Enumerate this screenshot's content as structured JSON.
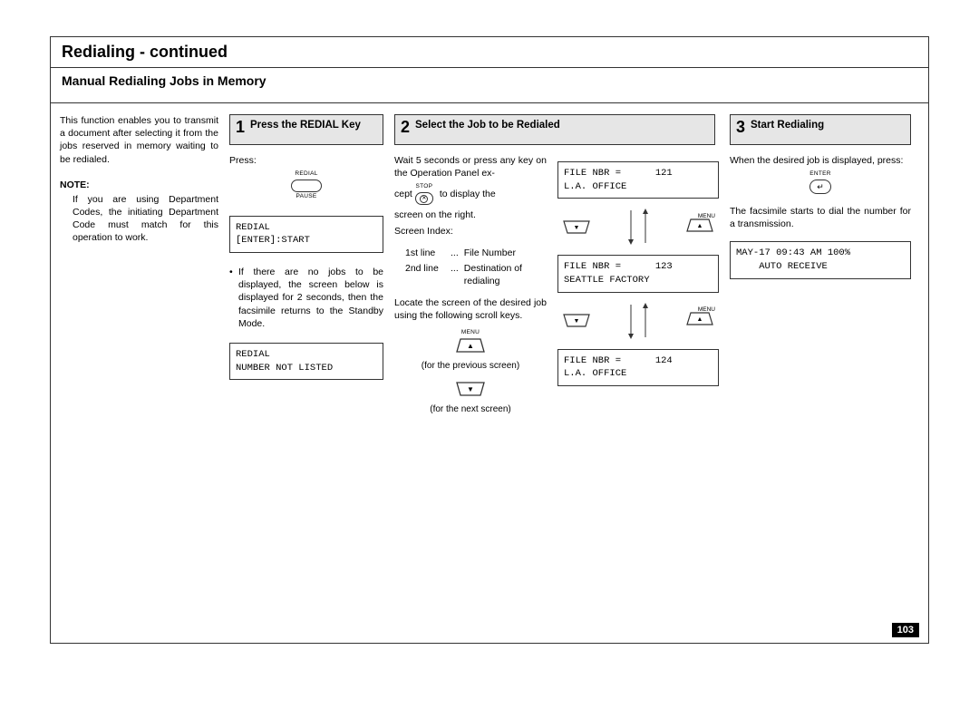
{
  "header": {
    "title": "Redialing - continued",
    "subtitle": "Manual Redialing Jobs in Memory"
  },
  "intro": {
    "text": "This function enables you to transmit a document after selecting it from the jobs reserved in memory waiting to be redialed.",
    "note_label": "NOTE:",
    "note_body": "If you are using Department Codes, the initiating Department Code must match for this operation to work."
  },
  "step1": {
    "num": "1",
    "title": "Press the REDIAL Key",
    "press": "Press:",
    "redial_top": "REDIAL",
    "redial_bottom": "PAUSE",
    "lcd1_line1": "REDIAL",
    "lcd1_line2": "[ENTER]:START",
    "bullet": "If there are no jobs to be displayed, the screen below is displayed for 2 seconds, then the facsimile returns to the Standby Mode.",
    "lcd2_line1": "REDIAL",
    "lcd2_line2": "NUMBER NOT LISTED"
  },
  "step2": {
    "num": "2",
    "title": "Select the Job to be Redialed",
    "para_a": "Wait 5 seconds or press any key on the Operation Panel ex-",
    "stop_top": "STOP",
    "cept": "cept",
    "para_a2": "to display the",
    "para_a3": "screen on the right.",
    "screen_index_label": "Screen Index:",
    "row1_lbl": "1st line",
    "row1_val": "File Number",
    "row2_lbl": "2nd line",
    "row2_val": "Destination of redialing",
    "para_b": "Locate the screen of the desired job using the following scroll keys.",
    "menu_label": "MENU",
    "prev_caption": "(for the previous screen)",
    "next_caption": "(for the next screen)",
    "lcd_a1": "FILE NBR =      121",
    "lcd_a2": "L.A. OFFICE",
    "lcd_b1": "FILE NBR =      123",
    "lcd_b2": "SEATTLE FACTORY",
    "lcd_c1": "FILE NBR =      124",
    "lcd_c2": "L.A. OFFICE"
  },
  "step3": {
    "num": "3",
    "title": "Start Redialing",
    "para_a": "When the desired job is displayed, press:",
    "enter_label": "ENTER",
    "para_b": "The facsimile starts to dial the number for a transmission.",
    "lcd_line1": "MAY-17 09:43 AM 100%",
    "lcd_line2": "    AUTO RECEIVE"
  },
  "page_number": "103"
}
